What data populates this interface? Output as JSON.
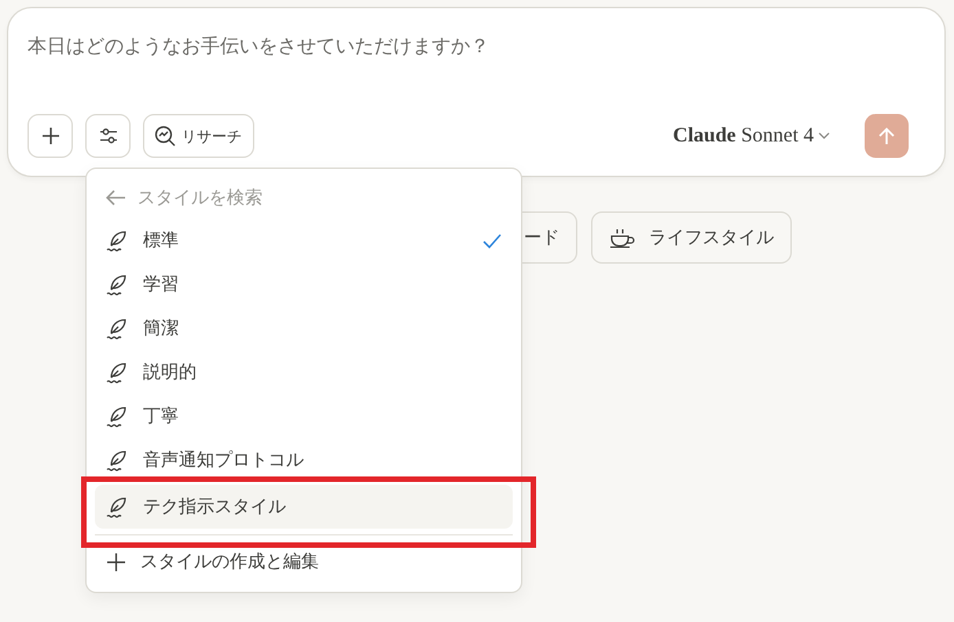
{
  "composer": {
    "placeholder": "本日はどのようなお手伝いをさせていただけますか？",
    "research_label": "リサーチ",
    "model": {
      "brand": "Claude",
      "name": "Sonnet 4"
    }
  },
  "chips": [
    {
      "kind": "code",
      "label": "ード"
    },
    {
      "kind": "lifestyle",
      "label": "ライフスタイル"
    }
  ],
  "style_menu": {
    "search_placeholder": "スタイルを検索",
    "items": [
      {
        "label": "標準",
        "selected": true,
        "highlighted": false
      },
      {
        "label": "学習",
        "selected": false,
        "highlighted": false
      },
      {
        "label": "簡潔",
        "selected": false,
        "highlighted": false
      },
      {
        "label": "説明的",
        "selected": false,
        "highlighted": false
      },
      {
        "label": "丁寧",
        "selected": false,
        "highlighted": false
      },
      {
        "label": "音声通知プロトコル",
        "selected": false,
        "highlighted": false
      },
      {
        "label": "テク指示スタイル",
        "selected": false,
        "highlighted": true
      }
    ],
    "footer": "スタイルの作成と編集"
  }
}
